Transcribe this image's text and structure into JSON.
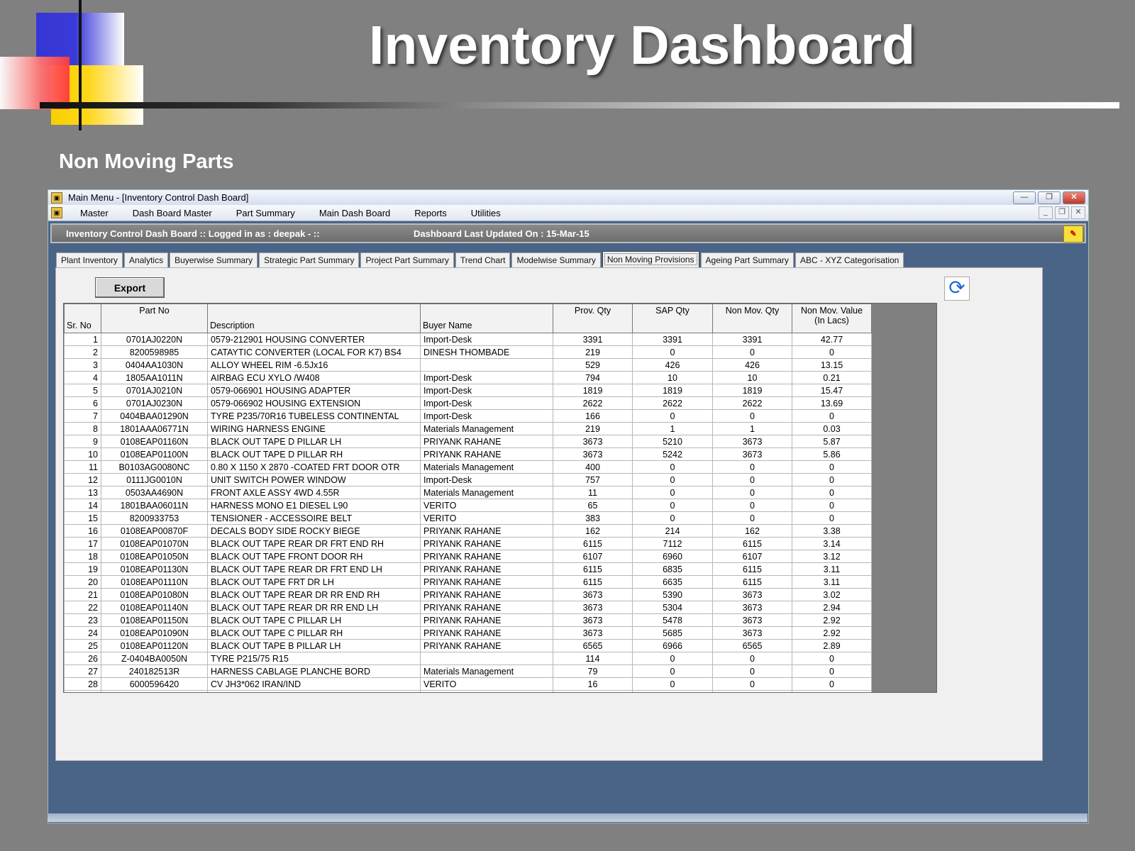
{
  "slide": {
    "title": "Inventory Dashboard",
    "subtitle": "Non Moving Parts"
  },
  "window": {
    "title": "Main Menu - [Inventory Control Dash Board]",
    "menu": [
      "Master",
      "Dash Board Master",
      "Part Summary",
      "Main Dash Board",
      "Reports",
      "Utilities"
    ],
    "status_left": "Inventory Control Dash Board :: Logged in as : deepak -   ::",
    "status_right": "Dashboard Last Updated On : 15-Mar-15"
  },
  "tabs": [
    {
      "label": "Plant Inventory"
    },
    {
      "label": "Analytics"
    },
    {
      "label": "Buyerwise Summary"
    },
    {
      "label": "Strategic Part Summary"
    },
    {
      "label": "Project Part Summary"
    },
    {
      "label": "Trend Chart"
    },
    {
      "label": "Modelwise Summary"
    },
    {
      "label": "Non Moving Provisions",
      "active": true
    },
    {
      "label": "Ageing Part Summary"
    },
    {
      "label": "ABC - XYZ Categorisation"
    }
  ],
  "toolbar": {
    "export_label": "Export"
  },
  "grid": {
    "columns": [
      "Sr. No",
      "Part No",
      "Description",
      "Buyer Name",
      "Prov. Qty",
      "SAP Qty",
      "Non Mov. Qty",
      "Non Mov. Value (In Lacs)"
    ],
    "rows": [
      [
        "1",
        "0701AJ0220N",
        "0579-212901 HOUSING CONVERTER",
        "Import-Desk",
        "3391",
        "3391",
        "3391",
        "42.77"
      ],
      [
        "2",
        "8200598985",
        "CATAYTIC CONVERTER (LOCAL FOR K7) BS4",
        "DINESH THOMBADE",
        "219",
        "0",
        "0",
        "0"
      ],
      [
        "3",
        "0404AA1030N",
        "ALLOY WHEEL RIM -6.5Jx16",
        "",
        "529",
        "426",
        "426",
        "13.15"
      ],
      [
        "4",
        "1805AA1011N",
        "AIRBAG ECU XYLO /W408",
        "Import-Desk",
        "794",
        "10",
        "10",
        "0.21"
      ],
      [
        "5",
        "0701AJ0210N",
        "0579-066901 HOUSING ADAPTER",
        "Import-Desk",
        "1819",
        "1819",
        "1819",
        "15.47"
      ],
      [
        "6",
        "0701AJ0230N",
        "0579-066902 HOUSING EXTENSION",
        "Import-Desk",
        "2622",
        "2622",
        "2622",
        "13.69"
      ],
      [
        "7",
        "0404BAA01290N",
        "TYRE P235/70R16 TUBELESS CONTINENTAL",
        "Import-Desk",
        "166",
        "0",
        "0",
        "0"
      ],
      [
        "8",
        "1801AAA06771N",
        "WIRING HARNESS ENGINE",
        "Materials Management",
        "219",
        "1",
        "1",
        "0.03"
      ],
      [
        "9",
        "0108EAP01160N",
        "BLACK OUT TAPE D PILLAR LH",
        "PRIYANK RAHANE",
        "3673",
        "5210",
        "3673",
        "5.87"
      ],
      [
        "10",
        "0108EAP01100N",
        "BLACK OUT TAPE D PILLAR RH",
        "PRIYANK RAHANE",
        "3673",
        "5242",
        "3673",
        "5.86"
      ],
      [
        "11",
        "B0103AG0080NC",
        "0.80 X 1150 X 2870 -COATED FRT DOOR OTR",
        "Materials Management",
        "400",
        "0",
        "0",
        "0"
      ],
      [
        "12",
        "0111JG0010N",
        "UNIT SWITCH POWER WINDOW",
        "Import-Desk",
        "757",
        "0",
        "0",
        "0"
      ],
      [
        "13",
        "0503AA4690N",
        "FRONT AXLE ASSY 4WD 4.55R",
        "Materials Management",
        "11",
        "0",
        "0",
        "0"
      ],
      [
        "14",
        "1801BAA06011N",
        "HARNESS MONO E1 DIESEL L90",
        "VERITO",
        "65",
        "0",
        "0",
        "0"
      ],
      [
        "15",
        "8200933753",
        "TENSIONER - ACCESSOIRE BELT",
        "VERITO",
        "383",
        "0",
        "0",
        "0"
      ],
      [
        "16",
        "0108EAP00870F",
        "DECALS BODY SIDE ROCKY BIEGE",
        "PRIYANK RAHANE",
        "162",
        "214",
        "162",
        "3.38"
      ],
      [
        "17",
        "0108EAP01070N",
        "BLACK OUT TAPE REAR DR FRT END RH",
        "PRIYANK RAHANE",
        "6115",
        "7112",
        "6115",
        "3.14"
      ],
      [
        "18",
        "0108EAP01050N",
        "BLACK OUT TAPE FRONT DOOR RH",
        "PRIYANK RAHANE",
        "6107",
        "6960",
        "6107",
        "3.12"
      ],
      [
        "19",
        "0108EAP01130N",
        "BLACK OUT TAPE REAR DR FRT END LH",
        "PRIYANK RAHANE",
        "6115",
        "6835",
        "6115",
        "3.11"
      ],
      [
        "20",
        "0108EAP01110N",
        "BLACK OUT TAPE FRT DR LH",
        "PRIYANK RAHANE",
        "6115",
        "6635",
        "6115",
        "3.11"
      ],
      [
        "21",
        "0108EAP01080N",
        "BLACK OUT TAPE REAR DR RR END RH",
        "PRIYANK RAHANE",
        "3673",
        "5390",
        "3673",
        "3.02"
      ],
      [
        "22",
        "0108EAP01140N",
        "BLACK OUT TAPE REAR DR RR END LH",
        "PRIYANK RAHANE",
        "3673",
        "5304",
        "3673",
        "2.94"
      ],
      [
        "23",
        "0108EAP01150N",
        "BLACK OUT TAPE C PILLAR LH",
        "PRIYANK RAHANE",
        "3673",
        "5478",
        "3673",
        "2.92"
      ],
      [
        "24",
        "0108EAP01090N",
        "BLACK OUT TAPE C PILLAR RH",
        "PRIYANK RAHANE",
        "3673",
        "5685",
        "3673",
        "2.92"
      ],
      [
        "25",
        "0108EAP01120N",
        "BLACK OUT TAPE B PILLAR LH",
        "PRIYANK RAHANE",
        "6565",
        "6966",
        "6565",
        "2.89"
      ],
      [
        "26",
        "Z-0404BA0050N",
        "TYRE P215/75 R15",
        "",
        "114",
        "0",
        "0",
        "0"
      ],
      [
        "27",
        "240182513R",
        "HARNESS CABLAGE PLANCHE BORD",
        "Materials Management",
        "79",
        "0",
        "0",
        "0"
      ],
      [
        "28",
        "6000596420",
        "CV JH3*062 IRAN/IND",
        "VERITO",
        "16",
        "0",
        "0",
        "0"
      ]
    ]
  },
  "colors": {
    "desktop": "#808080",
    "mdi_background": "#4a6488",
    "status_bar": "#7a7a7a",
    "panel": "#f0f0f0"
  },
  "icons": {
    "app": "app-icon",
    "refresh": "refresh-icon",
    "note": "sticky-note-icon"
  }
}
